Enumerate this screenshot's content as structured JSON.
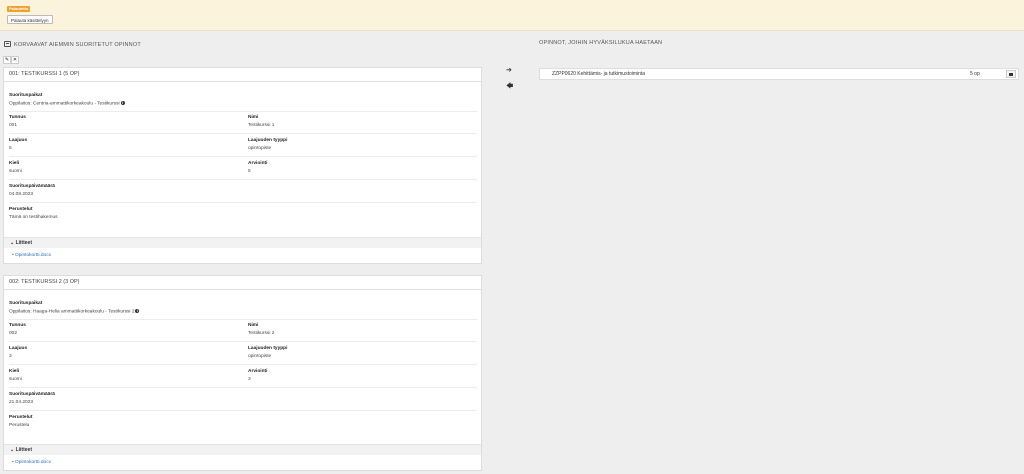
{
  "header": {
    "status_badge": "Palautettu",
    "return_button": "Palauta käsittelyyn"
  },
  "left": {
    "title": "KORVAAVAT AIEMMIN SUORITETUT OPINNOT",
    "tools": {
      "edit": "✎",
      "remove": "✕"
    }
  },
  "right": {
    "title": "OPINNOT, JOIHIN HYVÄKSILUKUA HAETAAN",
    "target": {
      "name": "ZZPP0620 Kehittämis- ja tutkimustoiminta",
      "credits": "5 op"
    }
  },
  "arrows": {
    "right": "➔",
    "left": "🡄"
  },
  "labels": {
    "places": "Suorituspaikat",
    "code": "Tunnus",
    "name": "Nimi",
    "scope": "Laajuus",
    "scope_type": "Laajuuden tyyppi",
    "language": "Kieli",
    "grade": "Arviointi",
    "date": "Suorituspäivämäärä",
    "reasons": "Perustelut",
    "attachments": "Liitteet"
  },
  "courses": [
    {
      "header": "001: TESTIKURSSI 1 (5 OP)",
      "place": "Oppilaitos: Centria-ammattikorkeakoulu - Testikurssi",
      "code": "001",
      "name": "Testikurssi 1",
      "scope": "5",
      "scope_type": "opintopiste",
      "language": "suomi",
      "grade": "5",
      "date": "04.08.2023",
      "reasons": "Tämä on testihakemus",
      "attachment": "Opintokortti.docx"
    },
    {
      "header": "002: TESTIKURSSI 2 (3 OP)",
      "place": "Oppilaitos: Haaga-Helia ammattikorkeakoulu - Testikurssi 2",
      "code": "002",
      "name": "Testikurssi 2",
      "scope": "3",
      "scope_type": "opintopiste",
      "language": "suomi",
      "grade": "3",
      "date": "21.04.2023",
      "reasons": "Perustelu",
      "attachment": "Opintokortti.docx"
    }
  ]
}
